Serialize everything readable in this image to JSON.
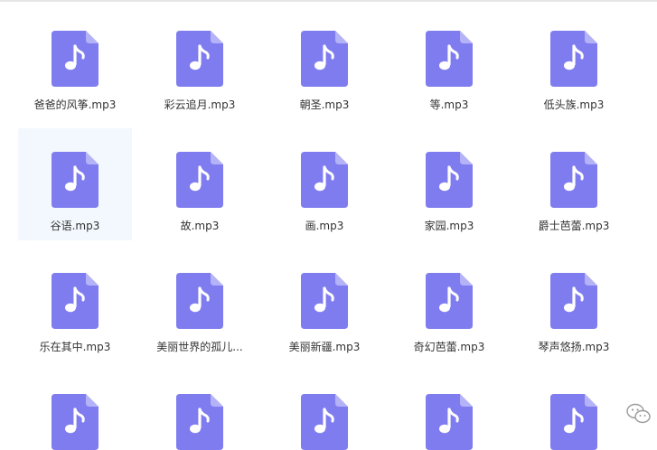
{
  "colors": {
    "icon_body": "#7f7cf0",
    "icon_fold": "#b5b3f7",
    "selected_bg": "#f2f8fd",
    "text": "#333333"
  },
  "icon": "music-note-file-icon",
  "files": [
    {
      "name": "爸爸的风筝.mp3"
    },
    {
      "name": "彩云追月.mp3"
    },
    {
      "name": "朝圣.mp3"
    },
    {
      "name": "等.mp3"
    },
    {
      "name": "低头族.mp3"
    },
    {
      "name": "谷语.mp3",
      "selected": true
    },
    {
      "name": "故.mp3"
    },
    {
      "name": "画.mp3"
    },
    {
      "name": "家园.mp3"
    },
    {
      "name": "爵士芭蕾.mp3"
    },
    {
      "name": "乐在其中.mp3"
    },
    {
      "name": "美丽世界的孤儿..."
    },
    {
      "name": "美丽新疆.mp3"
    },
    {
      "name": "奇幻芭蕾.mp3"
    },
    {
      "name": "琴声悠扬.mp3"
    },
    {
      "name": ""
    },
    {
      "name": ""
    },
    {
      "name": ""
    },
    {
      "name": ""
    },
    {
      "name": ""
    }
  ]
}
